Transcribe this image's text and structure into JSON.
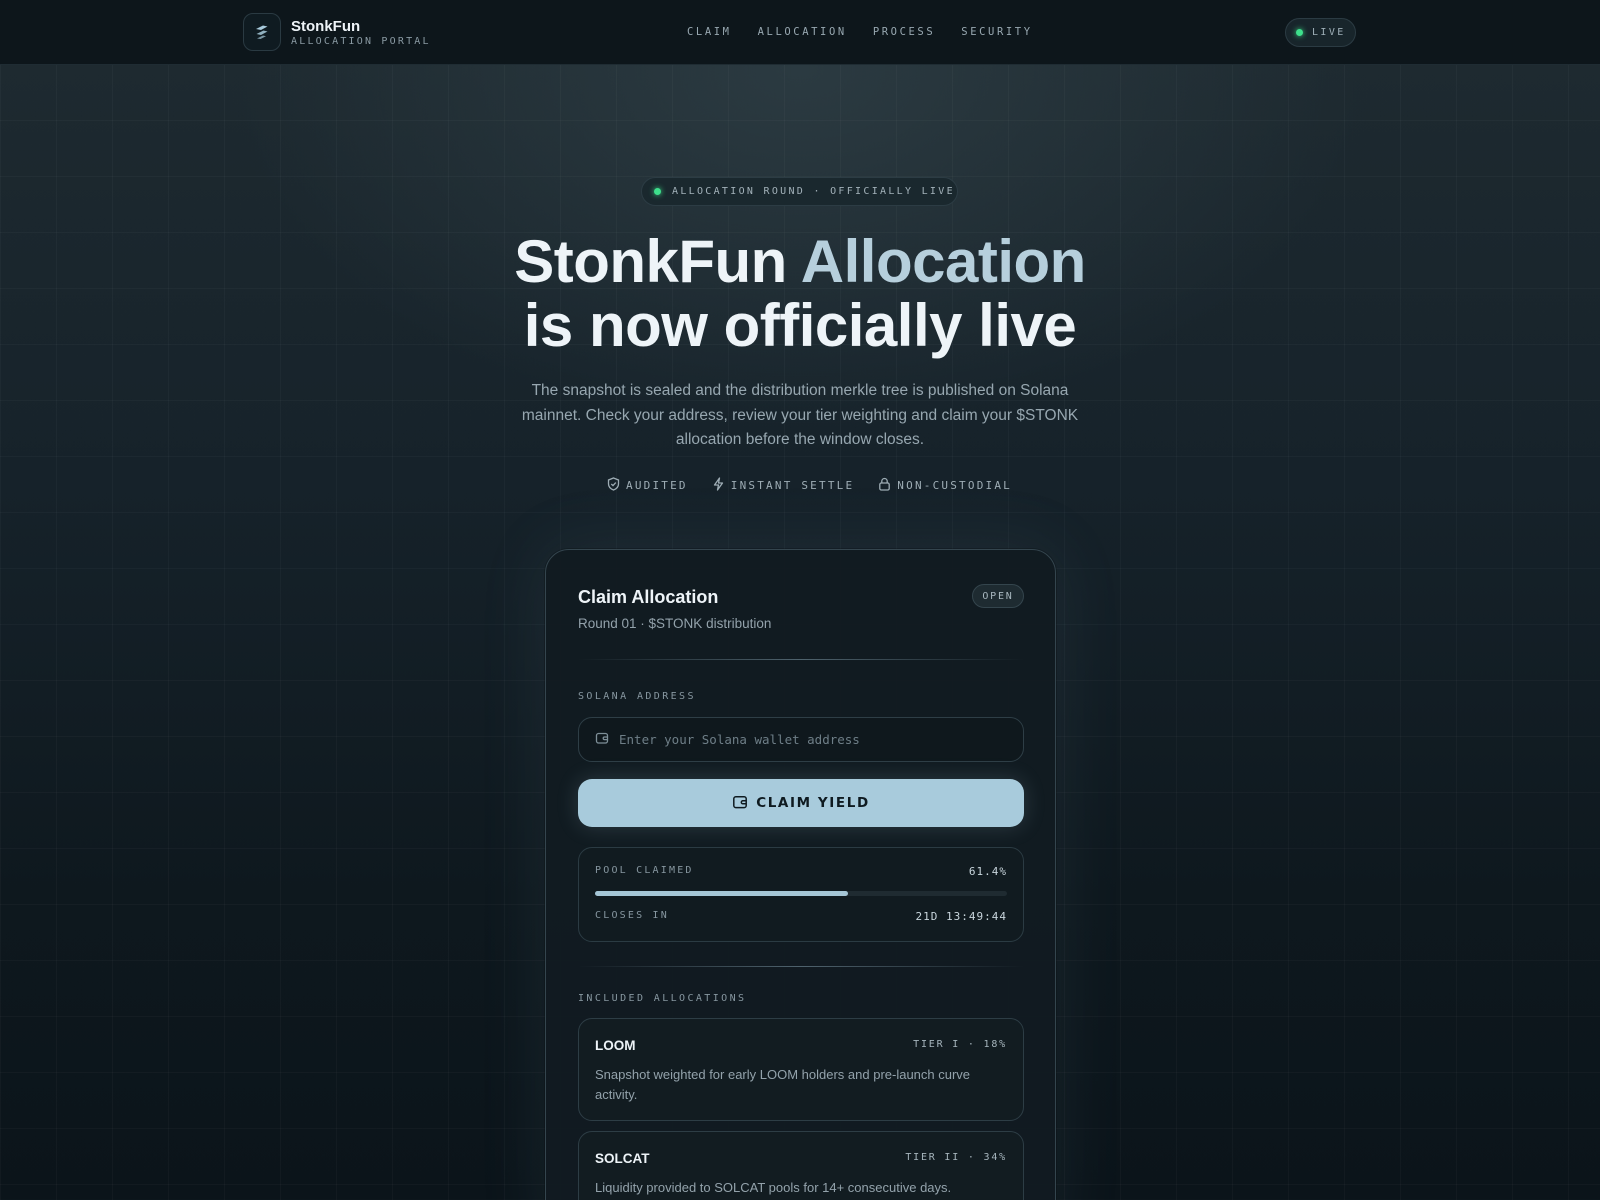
{
  "nav": {
    "brand_name": "StonkFun",
    "brand_sub": "ALLOCATION PORTAL",
    "links": [
      "CLAIM",
      "ALLOCATION",
      "PROCESS",
      "SECURITY"
    ],
    "live_label": "LIVE"
  },
  "hero": {
    "badge": "ALLOCATION ROUND · OFFICIALLY LIVE",
    "headline_part1": "StonkFun ",
    "headline_accent": "Allocation",
    "headline_line2": "is now officially live",
    "subtext": "The snapshot is sealed and the distribution merkle tree is published on Solana mainnet. Check your address, review your tier weighting and claim your $STONK allocation before the window closes.",
    "features": [
      {
        "icon": "shield-icon",
        "label": "AUDITED"
      },
      {
        "icon": "bolt-icon",
        "label": "INSTANT SETTLE"
      },
      {
        "icon": "lock-icon",
        "label": "NON-CUSTODIAL"
      }
    ]
  },
  "card": {
    "title": "Claim Allocation",
    "subtitle": "Round 01 · $STONK distribution",
    "status": "OPEN",
    "address_label": "SOLANA ADDRESS",
    "address_value": "",
    "address_placeholder": "Enter your Solana wallet address",
    "claim_button": "CLAIM YIELD",
    "pool_claimed_label": "POOL CLAIMED",
    "pool_claimed_value": "61.4%",
    "pool_claimed_fraction": 0.614,
    "closes_label": "CLOSES IN",
    "closes_value": "21D 13:49:44",
    "included_label": "INCLUDED ALLOCATIONS",
    "allocations": [
      {
        "name": "LOOM",
        "tier": "TIER I · 18%",
        "desc": "Snapshot weighted for early LOOM holders and pre-launch curve activity."
      },
      {
        "name": "SOLCAT",
        "tier": "TIER II · 34%",
        "desc": "Liquidity provided to SOLCAT pools for 14+ consecutive days."
      }
    ]
  },
  "colors": {
    "accent": "#a8cbdc",
    "live_dot": "#3ee08c",
    "background": "#0e181e"
  }
}
